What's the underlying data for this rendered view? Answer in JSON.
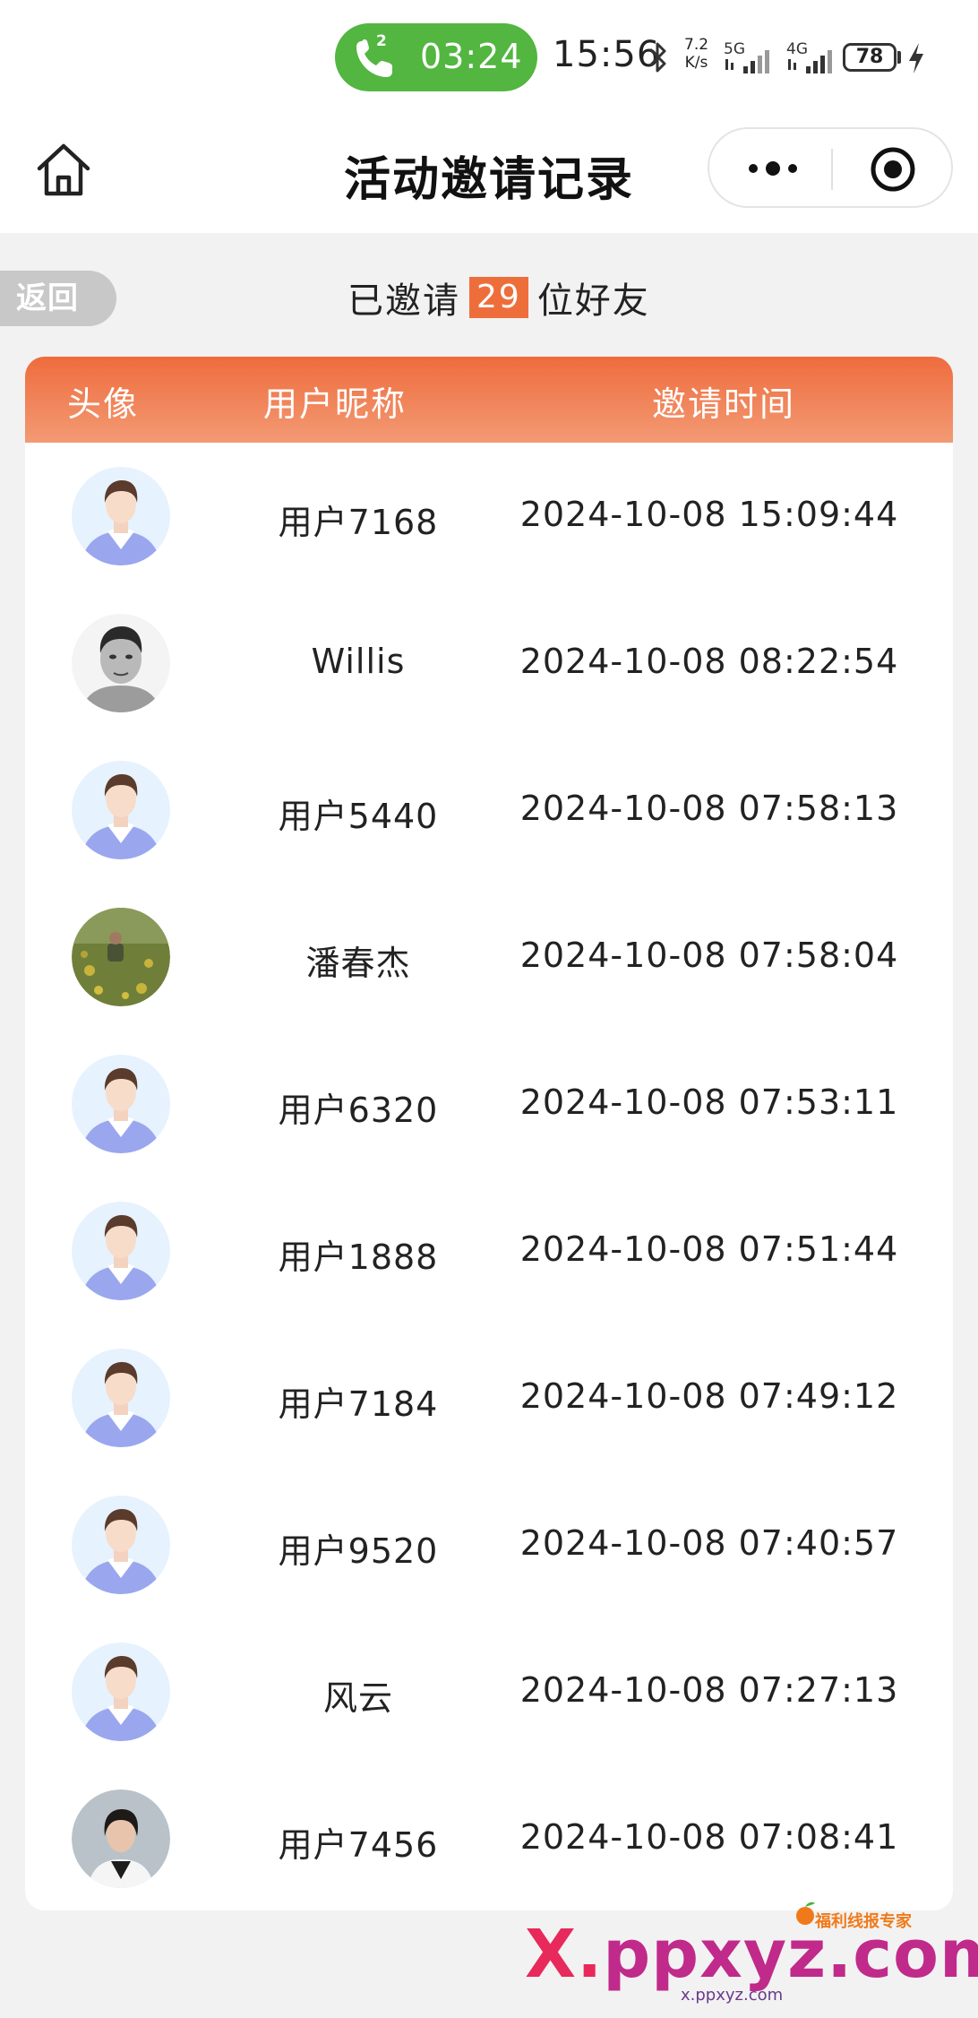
{
  "status_bar": {
    "call_count": "2",
    "call_duration": "03:24",
    "clock": "15:56",
    "net_speed_value": "7.2",
    "net_speed_unit": "K/s",
    "signal_1_label": "5G",
    "signal_2_label": "4G",
    "battery_level": "78"
  },
  "nav": {
    "title": "活动邀请记录"
  },
  "summary": {
    "back_label": "返回",
    "prefix": "已邀请",
    "count": "29",
    "suffix": "位好友"
  },
  "table": {
    "headers": {
      "avatar": "头像",
      "nickname": "用户昵称",
      "time": "邀请时间"
    },
    "rows": [
      {
        "avatar": "default-avatar",
        "nickname": "用户7168",
        "time": "2024-10-08 15:09:44"
      },
      {
        "avatar": "photo-avatar-bw-portrait",
        "nickname": "Willis",
        "time": "2024-10-08 08:22:54"
      },
      {
        "avatar": "default-avatar",
        "nickname": "用户5440",
        "time": "2024-10-08 07:58:13"
      },
      {
        "avatar": "photo-avatar-field",
        "nickname": "潘春杰",
        "time": "2024-10-08 07:58:04"
      },
      {
        "avatar": "default-avatar",
        "nickname": "用户6320",
        "time": "2024-10-08 07:53:11"
      },
      {
        "avatar": "default-avatar",
        "nickname": "用户1888",
        "time": "2024-10-08 07:51:44"
      },
      {
        "avatar": "default-avatar",
        "nickname": "用户7184",
        "time": "2024-10-08 07:49:12"
      },
      {
        "avatar": "default-avatar",
        "nickname": "用户9520",
        "time": "2024-10-08 07:40:57"
      },
      {
        "avatar": "default-avatar",
        "nickname": "风云",
        "time": "2024-10-08 07:27:13"
      },
      {
        "avatar": "photo-avatar-woman",
        "nickname": "用户7456",
        "time": "2024-10-08 07:08:41"
      }
    ]
  },
  "watermark": {
    "top": "福利线报专家",
    "x": "X",
    "dot": ".",
    "rest": "ppxyz.com",
    "sub": "x.ppxyz.com"
  },
  "colors": {
    "accent": "#ee6e3b",
    "header_gradient_top": "#ee6c3d",
    "header_gradient_bottom": "#f39a74",
    "call_pill": "#52b640",
    "page_bg": "#f2f2f2"
  }
}
